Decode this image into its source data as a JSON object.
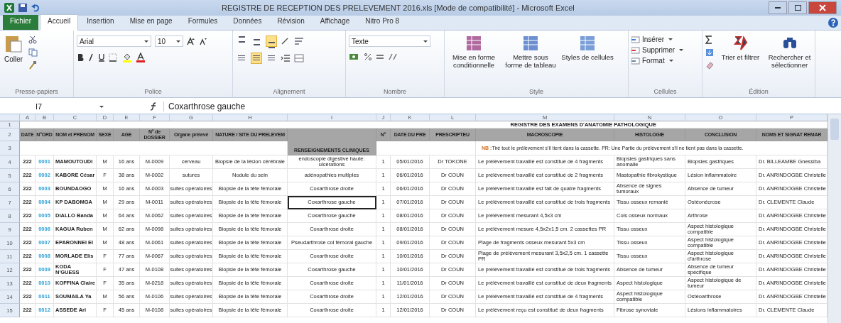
{
  "window": {
    "title": "REGISTRE DE RECEPTION DES  PRELEVEMENT 2016.xls  [Mode de compatibilité] - Microsoft Excel"
  },
  "tabs": [
    {
      "label": "Fichier",
      "kind": "file",
      "selected": false
    },
    {
      "label": "Accueil",
      "kind": "tab",
      "selected": true
    },
    {
      "label": "Insertion",
      "kind": "tab",
      "selected": false
    },
    {
      "label": "Mise en page",
      "kind": "tab",
      "selected": false
    },
    {
      "label": "Formules",
      "kind": "tab",
      "selected": false
    },
    {
      "label": "Données",
      "kind": "tab",
      "selected": false
    },
    {
      "label": "Révision",
      "kind": "tab",
      "selected": false
    },
    {
      "label": "Affichage",
      "kind": "tab",
      "selected": false
    },
    {
      "label": "Nitro Pro 8",
      "kind": "tab",
      "selected": false
    }
  ],
  "ribbon": {
    "clipboard": {
      "paste": "Coller",
      "label": "Presse-papiers"
    },
    "font": {
      "name": "Arial",
      "size": "10",
      "label": "Police"
    },
    "alignment": {
      "label": "Alignement",
      "top_buttons": [
        {
          "selected": false
        },
        {
          "selected": false
        },
        {
          "selected": true
        }
      ],
      "bottom_buttons": [
        {
          "selected": false
        },
        {
          "selected": true
        },
        {
          "selected": false
        }
      ]
    },
    "number": {
      "format": "Texte",
      "label": "Nombre"
    },
    "style": {
      "buttons": [
        "Mise en forme conditionnelle",
        "Mettre sous forme de tableau",
        "Styles de cellules"
      ],
      "label": "Style"
    },
    "cells": {
      "items": [
        "Insérer",
        "Supprimer",
        "Format"
      ],
      "label": "Cellules"
    },
    "editing": {
      "buttons": [
        "Trier et filtrer",
        "Rechercher et sélectionner"
      ],
      "label": "Édition"
    }
  },
  "formula_bar": {
    "name_box": "I7",
    "value": "Coxarthrose gauche"
  },
  "sheet": {
    "columns": [
      "A",
      "B",
      "C",
      "D",
      "E",
      "F",
      "G",
      "H",
      "I",
      "J",
      "K",
      "L",
      "M",
      "N",
      "O",
      "P"
    ],
    "title_row": {
      "number": "1",
      "text": "REGISTRE DES EXAMENS D'ANATOMIE PATHOLOGIQUE"
    },
    "header_row": {
      "number": "2",
      "cells": [
        "DATE",
        "N°ORD",
        "NOM et PRENOM",
        "SEXE",
        "AGE",
        "N° de DOSSIER",
        "Organe prélevé",
        "NATURE / SITE DU PRELEVEM",
        "N°",
        "DATE DU PRE",
        "PRESCRIPTEU",
        "MACROSCOPIE",
        "HISTOLOGIE",
        "CONCLUSION",
        "NOMS ET SIGNAT  REMAR"
      ]
    },
    "sub_row": {
      "number": "3",
      "clinical": "RENSEIGNEMENTS CLINIQUES",
      "note_mark": "NB :",
      "note": "Tiré tout le prélèvement s'il tient dans la cassette. PR: Une Partie du prélèvement s'il ne tient pas dans la cassette."
    },
    "rows": [
      {
        "number": "4",
        "cells": [
          "222",
          "0001",
          "MAMOUTOUDI",
          "M",
          "16 ans",
          "M-0009",
          "cerveau",
          "Biopsie de la lésion cérébrale",
          "endoscopie digestive haute: ulcérations",
          "1",
          "05/01/2016",
          "Dr TOKONE",
          "Le prélèvement travaillé est constitué de 4 fragments",
          "Biopsies gastriques sans anomalie",
          "Biopsies gastriques",
          "Dr. BILLEAMBE Gnessiba"
        ]
      },
      {
        "number": "5",
        "cells": [
          "222",
          "0002",
          "KABORE César",
          "F",
          "38 ans",
          "M-0002",
          "sutures",
          "Nodule du sein",
          "adénopathies multiples",
          "1",
          "06/01/2016",
          "Dr COUN",
          "Le prélèvement travaillé est constitué de 2 fragments",
          "Mastopathie fibrokystique",
          "Lésion inflammatoire",
          "Dr. ANRINDOGBE Christelle"
        ]
      },
      {
        "number": "6",
        "cells": [
          "222",
          "0003",
          "BOUNDAOGO",
          "M",
          "16 ans",
          "M-0003",
          "suites opératoires",
          "Biopsie de la tête fémorale",
          "Coxarthrose droite",
          "1",
          "06/01/2016",
          "Dr COUN",
          "Le prélèvement travaillé est fait de quatre fragments",
          "Absence de signes tumoraux",
          "Absence de tumeur",
          "Dr. ANRINDOGBE Christelle"
        ]
      },
      {
        "number": "7",
        "cells": [
          "222",
          "0004",
          "KP DABOMGA",
          "M",
          "29 ans",
          "M-0011",
          "suites opératoires",
          "Biopsie de la tête fémorale",
          "Coxarthrose gauche",
          "1",
          "07/01/2016",
          "Dr COUN",
          "Le prélèvement travaillé est constitué de trois fragments",
          "Tissu osseux remanié",
          "Ostéonécrose",
          "Dr. CLEMENTE Claude"
        ]
      },
      {
        "number": "8",
        "cells": [
          "222",
          "0005",
          "DIALLO Banda",
          "M",
          "64 ans",
          "M-0062",
          "suites opératoires",
          "Biopsie de la tête fémorale",
          "Coxarthrose gauche",
          "1",
          "08/01/2016",
          "Dr COUN",
          "Le prélèvement mesurant 4,5x3 cm",
          "Cols osseux normaux",
          "Arthrose",
          "Dr. ANRINDOGBE Christelle"
        ]
      },
      {
        "number": "9",
        "cells": [
          "222",
          "0006",
          "KAGUA Ruben",
          "M",
          "62 ans",
          "M-0098",
          "suites opératoires",
          "Biopsie de la tête fémorale",
          "Coxarthrose droite",
          "1",
          "08/01/2016",
          "Dr COUN",
          "Le prélèvement mesure 4,5x2x1,5 cm. 2 cassettes PR",
          "Tissu osseux",
          "Aspect histologique compatible",
          "Dr. ANRINDOGBE Christelle"
        ]
      },
      {
        "number": "10",
        "cells": [
          "222",
          "0007",
          "EPARONNEI El",
          "M",
          "48 ans",
          "M-0061",
          "suites opératoires",
          "Biopsie de la tête fémorale",
          "Pseudarthrose col fémoral gauche",
          "1",
          "09/01/2016",
          "Dr COUN",
          "Plage de fragments osseux mesurant 5x3 cm",
          "Tissu osseux",
          "Aspect histologique compatible",
          "Dr. ANRINDOGBE Christelle"
        ]
      },
      {
        "number": "11",
        "cells": [
          "222",
          "0008",
          "MORLADE Elis",
          "F",
          "77 ans",
          "M-0067",
          "suites opératoires",
          "Biopsie de la tête fémorale",
          "Coxarthrose droite",
          "1",
          "10/01/2016",
          "Dr COUN",
          "Plage de prélèvement mesurant 3,5x2,5 cm. 1 cassette PR",
          "Tissu osseux",
          "Aspect histologique d'arthrose",
          "Dr. ANRINDOGBE Christelle"
        ]
      },
      {
        "number": "12",
        "cells": [
          "222",
          "0009",
          "KODA N'GUESS",
          "F",
          "47 ans",
          "M-0108",
          "suites opératoires",
          "Biopsie de la tête fémorale",
          "Coxarthrose gauche",
          "1",
          "10/01/2016",
          "Dr COUN",
          "Le prélèvement travaillé est constitué de trois fragments",
          "Absence de tumeur",
          "Absence de tumeur spécifique",
          "Dr. ANRINDOGBE Christelle"
        ]
      },
      {
        "number": "13",
        "cells": [
          "222",
          "0010",
          "KOFFINA Claire",
          "F",
          "35 ans",
          "M-0218",
          "suites opératoires",
          "Biopsie de la tête fémorale",
          "Coxarthrose droite",
          "1",
          "11/01/2016",
          "Dr COUN",
          "Le prélèvement travaillé est constitué de deux fragments",
          "Aspect histologique",
          "Aspect histologique de tumeur",
          "Dr. ANRINDOGBE Christelle"
        ]
      },
      {
        "number": "14",
        "cells": [
          "222",
          "0011",
          "SOUMAILA Ya",
          "M",
          "56 ans",
          "M-0106",
          "suites opératoires",
          "Biopsie de la tête fémorale",
          "Coxarthrose droite",
          "1",
          "12/01/2016",
          "Dr COUN",
          "Le prélèvement travaillé est constitué de 4 fragments",
          "Aspect histologique compatible",
          "Ostéoarthrose",
          "Dr. ANRINDOGBE Christelle"
        ]
      },
      {
        "number": "15",
        "cells": [
          "222",
          "0012",
          "ASSEDE Ari",
          "F",
          "45 ans",
          "M-0108",
          "suites opératoires",
          "Biopsie de la tête fémorale",
          "Coxarthrose droite",
          "1",
          "12/01/2016",
          "Dr COUN",
          "Le prélèvement reçu est constitué de deux fragments",
          "Fibrose synoviale",
          "Lésions inflammatoires",
          "Dr. CLEMENTE Claude"
        ]
      }
    ]
  }
}
